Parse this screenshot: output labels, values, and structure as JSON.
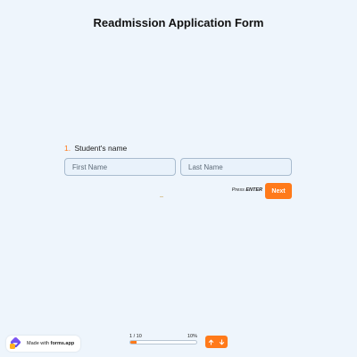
{
  "form": {
    "title": "Readmission Application Form"
  },
  "question": {
    "number": "1.",
    "label": "Student's name",
    "first_name_placeholder": "First Name",
    "last_name_placeholder": "Last Name",
    "first_name_value": "",
    "last_name_value": ""
  },
  "submit": {
    "press_text": "Press",
    "press_key": "ENTER",
    "next_label": "Next"
  },
  "badge": {
    "made_with": "Made with",
    "brand": "forms.app",
    "icon": "forms-app-logo-icon"
  },
  "progress": {
    "count_label": "1 / 10",
    "percent_label": "10%",
    "fraction": 0.1
  },
  "navigation": {
    "up_icon": "arrow-up-icon",
    "down_icon": "arrow-down-icon"
  },
  "colors": {
    "accent": "#ff7a1a",
    "background": "#eef5fc",
    "input_border": "#a9bccf",
    "input_background": "#e9f2fb"
  }
}
